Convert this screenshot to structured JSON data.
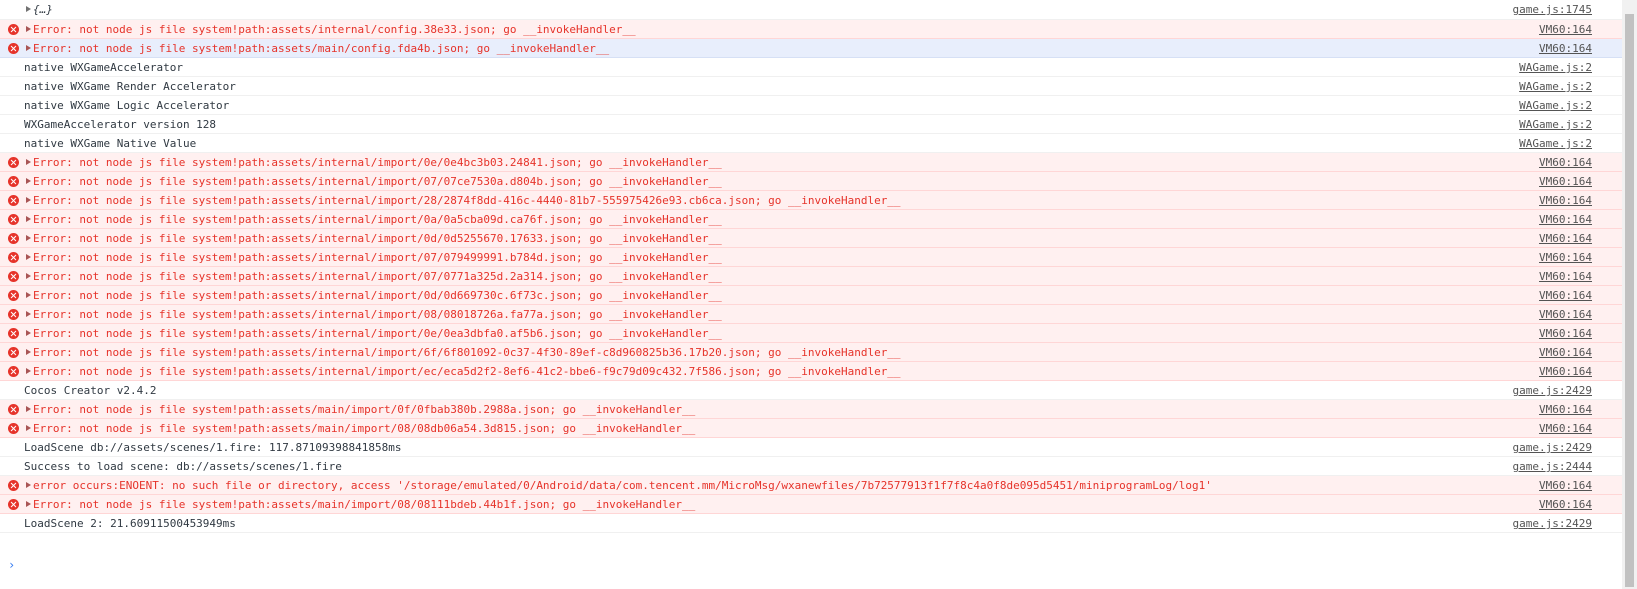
{
  "console": {
    "rows": [
      {
        "type": "object",
        "text": "{…}",
        "source": "game.js:1745"
      },
      {
        "type": "error",
        "text": "Error: not node js file system!path:assets/internal/config.38e33.json; go __invokeHandler__",
        "source": "VM60:164"
      },
      {
        "type": "error",
        "selected": true,
        "text": "Error: not node js file system!path:assets/main/config.fda4b.json; go __invokeHandler__",
        "source": "VM60:164"
      },
      {
        "type": "log",
        "text": "native WXGameAccelerator",
        "source": "WAGame.js:2"
      },
      {
        "type": "log",
        "text": "native WXGame Render Accelerator",
        "source": "WAGame.js:2"
      },
      {
        "type": "log",
        "text": "native WXGame Logic Accelerator",
        "source": "WAGame.js:2"
      },
      {
        "type": "log",
        "text": "WXGameAccelerator version 128",
        "source": "WAGame.js:2"
      },
      {
        "type": "log",
        "text": "native WXGame Native Value",
        "source": "WAGame.js:2"
      },
      {
        "type": "error",
        "text": "Error: not node js file system!path:assets/internal/import/0e/0e4bc3b03.24841.json; go __invokeHandler__",
        "source": "VM60:164"
      },
      {
        "type": "error",
        "text": "Error: not node js file system!path:assets/internal/import/07/07ce7530a.d804b.json; go __invokeHandler__",
        "source": "VM60:164"
      },
      {
        "type": "error",
        "text": "Error: not node js file system!path:assets/internal/import/28/2874f8dd-416c-4440-81b7-555975426e93.cb6ca.json; go __invokeHandler__",
        "source": "VM60:164"
      },
      {
        "type": "error",
        "text": "Error: not node js file system!path:assets/internal/import/0a/0a5cba09d.ca76f.json; go __invokeHandler__",
        "source": "VM60:164"
      },
      {
        "type": "error",
        "text": "Error: not node js file system!path:assets/internal/import/0d/0d5255670.17633.json; go __invokeHandler__",
        "source": "VM60:164"
      },
      {
        "type": "error",
        "text": "Error: not node js file system!path:assets/internal/import/07/079499991.b784d.json; go __invokeHandler__",
        "source": "VM60:164"
      },
      {
        "type": "error",
        "text": "Error: not node js file system!path:assets/internal/import/07/0771a325d.2a314.json; go __invokeHandler__",
        "source": "VM60:164"
      },
      {
        "type": "error",
        "text": "Error: not node js file system!path:assets/internal/import/0d/0d669730c.6f73c.json; go __invokeHandler__",
        "source": "VM60:164"
      },
      {
        "type": "error",
        "text": "Error: not node js file system!path:assets/internal/import/08/08018726a.fa77a.json; go __invokeHandler__",
        "source": "VM60:164"
      },
      {
        "type": "error",
        "text": "Error: not node js file system!path:assets/internal/import/0e/0ea3dbfa0.af5b6.json; go __invokeHandler__",
        "source": "VM60:164"
      },
      {
        "type": "error",
        "text": "Error: not node js file system!path:assets/internal/import/6f/6f801092-0c37-4f30-89ef-c8d960825b36.17b20.json; go __invokeHandler__",
        "source": "VM60:164"
      },
      {
        "type": "error",
        "text": "Error: not node js file system!path:assets/internal/import/ec/eca5d2f2-8ef6-41c2-bbe6-f9c79d09c432.7f586.json; go __invokeHandler__",
        "source": "VM60:164"
      },
      {
        "type": "log",
        "text": "Cocos Creator v2.4.2",
        "source": "game.js:2429"
      },
      {
        "type": "error",
        "text": "Error: not node js file system!path:assets/main/import/0f/0fbab380b.2988a.json; go __invokeHandler__",
        "source": "VM60:164"
      },
      {
        "type": "error",
        "text": "Error: not node js file system!path:assets/main/import/08/08db06a54.3d815.json; go __invokeHandler__",
        "source": "VM60:164"
      },
      {
        "type": "log",
        "text": "LoadScene db://assets/scenes/1.fire: 117.87109398841858ms",
        "source": "game.js:2429"
      },
      {
        "type": "log",
        "text": "Success to load scene: db://assets/scenes/1.fire",
        "source": "game.js:2444"
      },
      {
        "type": "error",
        "text": "error occurs:ENOENT: no such file or directory, access '/storage/emulated/0/Android/data/com.tencent.mm/MicroMsg/wxanewfiles/7b72577913f1f7f8c4a0f8de095d5451/miniprogramLog/log1'",
        "source": "VM60:164"
      },
      {
        "type": "error",
        "text": "Error: not node js file system!path:assets/main/import/08/08111bdeb.44b1f.json; go __invokeHandler__",
        "source": "VM60:164"
      },
      {
        "type": "log",
        "text": "LoadScene 2: 21.60911500453949ms",
        "source": "game.js:2429"
      }
    ],
    "prompt_symbol": "›",
    "icons": {
      "error": "error-circle-icon",
      "expand": "expand-triangle-icon",
      "prompt": "prompt-chevron-icon"
    },
    "colors": {
      "error_text": "#e6332a",
      "error_background": "#fff0f0",
      "selected_background": "#e8eefc",
      "prompt": "#367cf1"
    }
  }
}
